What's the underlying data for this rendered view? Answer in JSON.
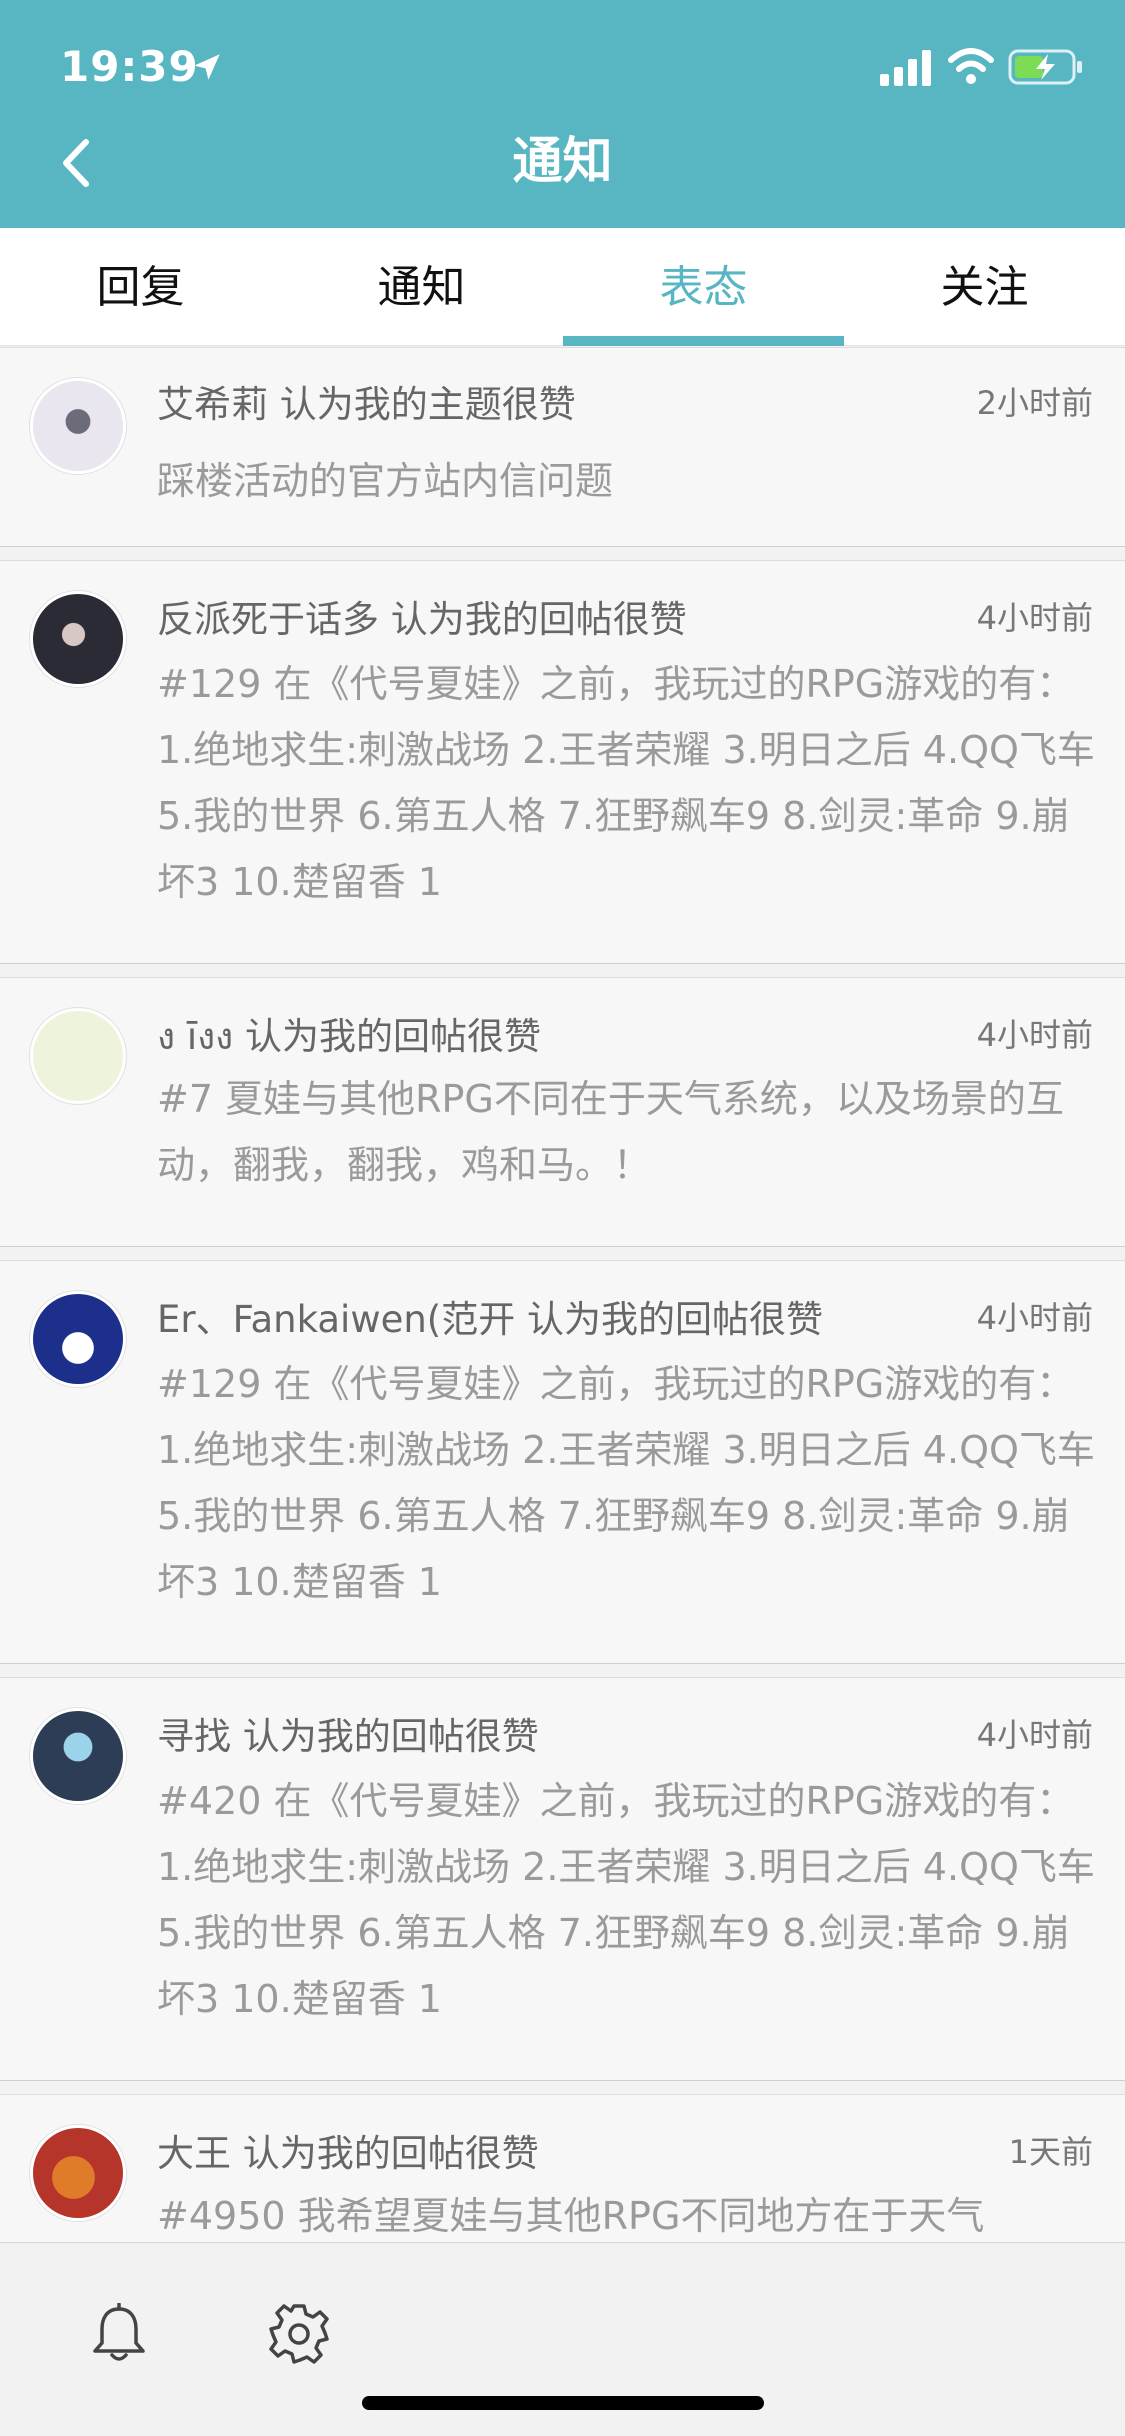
{
  "status_bar": {
    "time": "19:39"
  },
  "header": {
    "title": "通知"
  },
  "tabs": [
    {
      "label": "回复",
      "active": false
    },
    {
      "label": "通知",
      "active": false
    },
    {
      "label": "表态",
      "active": true
    },
    {
      "label": "关注",
      "active": false
    }
  ],
  "notifications": [
    {
      "title": "艾希莉 认为我的主题很赞",
      "time": "2小时前",
      "body": "踩楼活动的官方站内信问题"
    },
    {
      "title": "反派死于话多 认为我的回帖很赞",
      "time": "4小时前",
      "body": "#129 在《代号夏娃》之前，我玩过的RPG游戏的有： 1.绝地求生:刺激战场 2.王者荣耀 3.明日之后 4.QQ飞车 5.我的世界 6.第五人格 7.狂野飙车9 8.剑灵:革命 9.崩坏3 10.楚留香 1"
    },
    {
      "title": "ง īงง  认为我的回帖很赞",
      "time": "4小时前",
      "body": "#7 夏娃与其他RPG不同在于天气系统，以及场景的互动，翻我，翻我，鸡和马。！"
    },
    {
      "title": "Er、Fankaiwen(范开 认为我的回帖很赞",
      "time": "4小时前",
      "body": "#129 在《代号夏娃》之前，我玩过的RPG游戏的有： 1.绝地求生:刺激战场 2.王者荣耀 3.明日之后 4.QQ飞车 5.我的世界 6.第五人格 7.狂野飙车9 8.剑灵:革命 9.崩坏3 10.楚留香 1"
    },
    {
      "title": "寻找 认为我的回帖很赞",
      "time": "4小时前",
      "body": "#420 在《代号夏娃》之前，我玩过的RPG游戏的有： 1.绝地求生:刺激战场 2.王者荣耀 3.明日之后 4.QQ飞车 5.我的世界 6.第五人格 7.狂野飙车9 8.剑灵:革命 9.崩坏3 10.楚留香 1"
    },
    {
      "title": "大王 认为我的回帖很赞",
      "time": "1天前",
      "body": "#4950 我希望夏娃与其他RPG不同地方在于天气"
    }
  ],
  "colors": {
    "accent": "#57b6c2",
    "muted_text": "#9a9a9a"
  },
  "icons": {
    "back": "chevron-left-icon",
    "bell": "bell-icon",
    "settings": "gear-icon"
  }
}
